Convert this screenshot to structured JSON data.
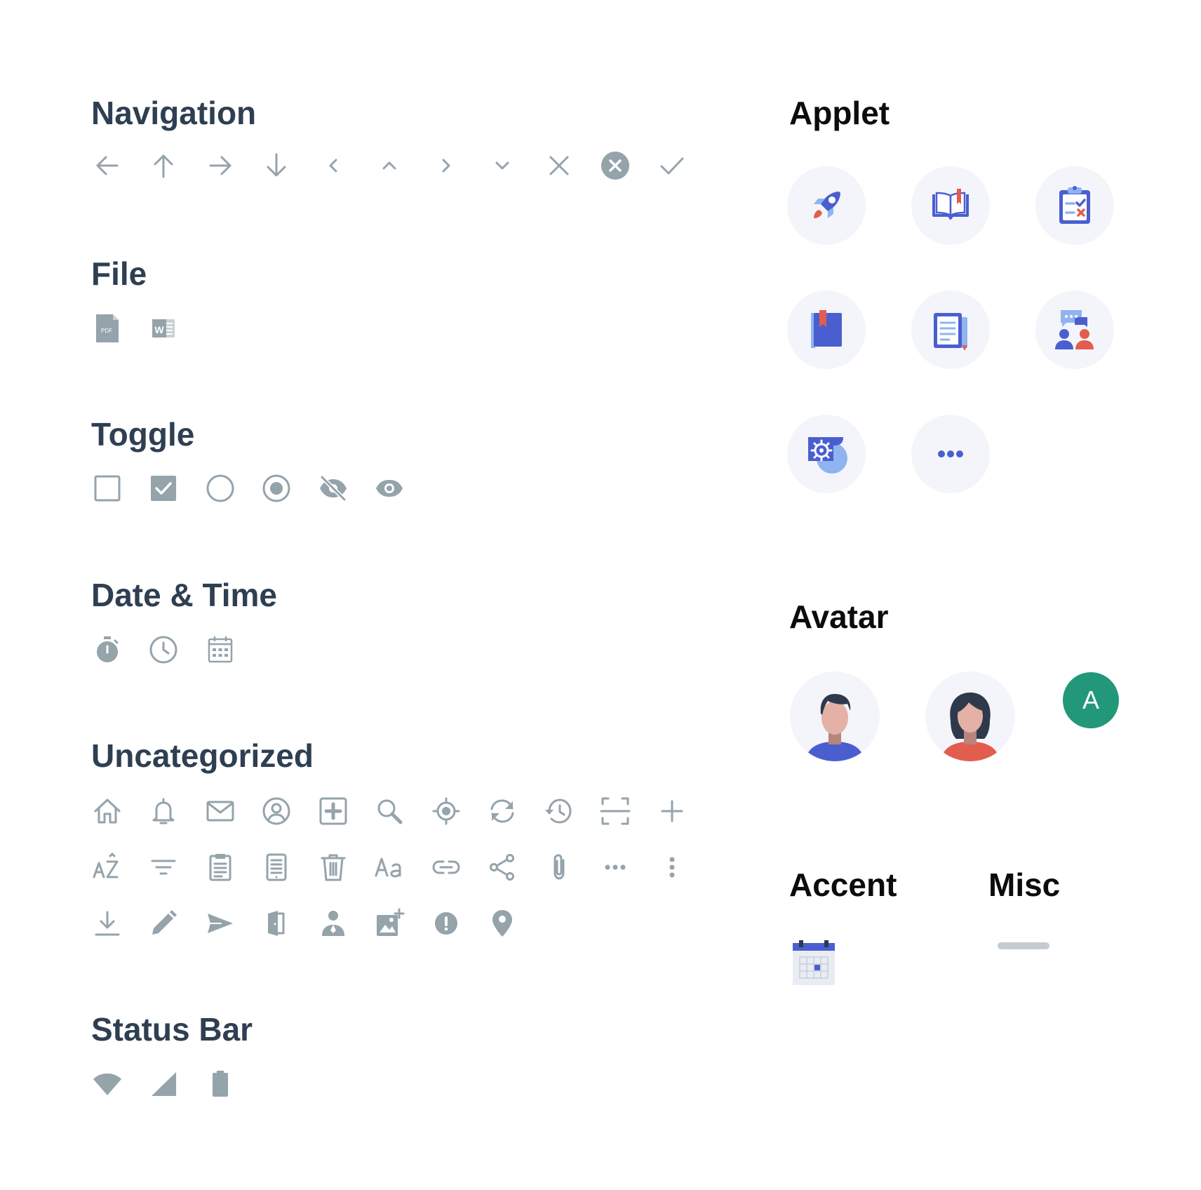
{
  "sections": {
    "navigation": "Navigation",
    "file": "File",
    "toggle": "Toggle",
    "date_time": "Date & Time",
    "uncategorized": "Uncategorized",
    "status_bar": "Status Bar",
    "applet": "Applet",
    "avatar": "Avatar",
    "accent": "Accent",
    "misc": "Misc"
  },
  "file_icon_labels": {
    "pdf": "PDF",
    "word": "W"
  },
  "avatar_initial": "A",
  "colors": {
    "icon_grey": "#95a3ab",
    "heading_dark": "#2f3f52",
    "applet_blue": "#4a5fcf",
    "applet_light_blue": "#8fb4f0",
    "applet_red": "#e35d4f",
    "applet_bg": "#f4f5fb",
    "avatar_green": "#22977a"
  },
  "icons": {
    "navigation": [
      "arrow-left-icon",
      "arrow-up-icon",
      "arrow-right-icon",
      "arrow-down-icon",
      "chevron-left-icon",
      "chevron-up-icon",
      "chevron-right-icon",
      "chevron-down-icon",
      "close-icon",
      "close-circle-icon",
      "check-icon"
    ],
    "file": [
      "pdf-file-icon",
      "word-file-icon"
    ],
    "toggle": [
      "checkbox-unchecked-icon",
      "checkbox-checked-icon",
      "radio-unchecked-icon",
      "radio-checked-icon",
      "eye-off-icon",
      "eye-icon"
    ],
    "date_time": [
      "stopwatch-icon",
      "clock-icon",
      "calendar-icon"
    ],
    "uncategorized": [
      "home-icon",
      "bell-icon",
      "mail-icon",
      "user-circle-icon",
      "add-box-icon",
      "search-icon",
      "locate-icon",
      "refresh-icon",
      "history-icon",
      "scan-icon",
      "plus-icon",
      "sort-az-icon",
      "filter-icon",
      "clipboard-icon",
      "notes-icon",
      "trash-icon",
      "text-format-icon",
      "link-icon",
      "share-icon",
      "attachment-icon",
      "more-horizontal-icon",
      "more-vertical-icon",
      "download-icon",
      "pencil-icon",
      "send-icon",
      "logout-door-icon",
      "person-pin-icon",
      "add-image-icon",
      "alert-circle-icon",
      "location-pin-icon"
    ],
    "status_bar": [
      "wifi-icon",
      "cellular-signal-icon",
      "battery-icon"
    ],
    "applet": [
      "rocket-icon",
      "open-book-icon",
      "checklist-icon",
      "bookmark-book-icon",
      "document-icon",
      "chat-people-icon",
      "settings-applet-icon",
      "more-applets-icon"
    ],
    "accent": [
      "calendar-accent-icon"
    ]
  }
}
